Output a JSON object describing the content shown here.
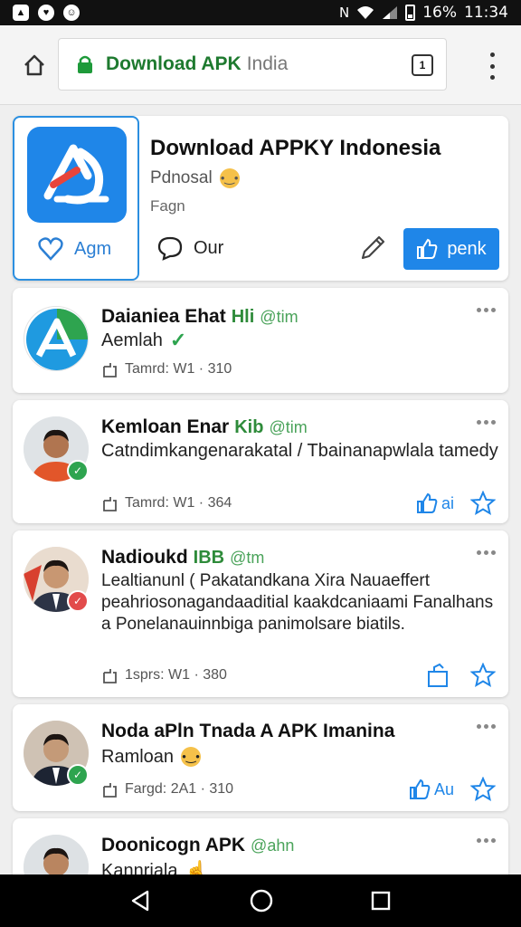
{
  "status": {
    "battery": "16%",
    "time": "11:34"
  },
  "browser": {
    "url_main": "Download APK",
    "url_rest": "India",
    "tabs_count": "1"
  },
  "app_card": {
    "title": "Download APPKY Indonesia",
    "subtitle": "Pdnosal",
    "subtitle2": "Fagn",
    "like_label": "Agm",
    "comment_label": "Our",
    "cta_label": "penk",
    "brand_color": "#1f86e8"
  },
  "posts": [
    {
      "name": "Daianiea Ehat",
      "tag": "Hli",
      "handle": "@tim",
      "text": "Aemlah",
      "meta": "Tamrd: W1 · 310"
    },
    {
      "name": "Kemloan Enar",
      "tag": "Kib",
      "handle": "@tim",
      "text": "Catndimkangenarakatal / Tbainanapwlala tamedy",
      "meta": "Tamrd: W1 · 364",
      "like_label": "ai"
    },
    {
      "name": "Nadioukd",
      "tag": "IBB",
      "handle": "@tm",
      "text": "Lealtianunl ( Pakatandkana Xira Nauaeffert peahriosonagandaaditial kaakdcaniaami Fanalhans a Ponelanauinnbiga panimolsare biatils.",
      "meta": "1sprs: W1 · 380"
    },
    {
      "name": "Noda aPln Tnada A APK Imanina",
      "tag": "",
      "handle": "",
      "text": "Ramloan",
      "meta": "Fargd: 2A1 · 310",
      "like_label": "Au"
    },
    {
      "name": "Doonicogn APK",
      "tag": "",
      "handle": "@ahn",
      "text": "Kannriala",
      "meta": ""
    }
  ]
}
